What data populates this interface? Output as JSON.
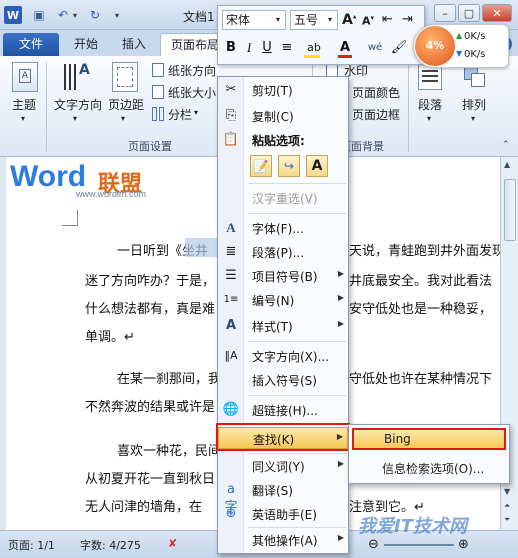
{
  "window": {
    "title": "文档1 [兼容",
    "min": "–",
    "max": "▢",
    "close": "✕"
  },
  "tabs": [
    "文件",
    "开始",
    "插入",
    "页面布局"
  ],
  "ribbon": {
    "theme_label": "主题",
    "text_direction_label": "文字方向",
    "margins_label": "页边距",
    "orientation_label": "纸张方向",
    "size_label": "纸张大小",
    "columns_label": "分栏",
    "page_setup_group": "页面设置",
    "watermark_label": "水印",
    "page_color_label": "页面颜色",
    "page_border_label": "页面边框",
    "page_background_group": "页面背景",
    "paragraph_label": "段落",
    "arrange_label": "排列"
  },
  "mini_toolbar": {
    "font": "宋体",
    "size": "五号"
  },
  "speed": {
    "percent": "4%",
    "up": "0K/s",
    "down": "0K/s"
  },
  "logo": {
    "text_word": "Word",
    "text_cn": "联盟",
    "site": "www.wordlm.com"
  },
  "document": {
    "lines": [
      "一日听到《坐井",
      "迷了方向咋办？于是，",
      "什么想法都有，真是难",
      "单调。↵",
      "在某一刹那间，我",
      "不然奔波的结果或许是",
      "喜欢一种花，民间",
      "从初夏开花一直到秋日",
      "无人问津的墙角，在"
    ],
    "right_lines": [
      "天说，青蛙跑到井外面发现",
      "井底最安全。我对此看法",
      "安守低处也是一种稳妥，",
      "守低处也许在某种情况下",
      "注意到它。↵"
    ]
  },
  "context_menu": {
    "cut": "剪切(T)",
    "copy": "复制(C)",
    "paste_options": "粘贴选项:",
    "reconvert": "汉字重选(V)",
    "font": "字体(F)...",
    "paragraph": "段落(P)...",
    "bullets": "项目符号(B)",
    "numbering": "编号(N)",
    "styles": "样式(T)",
    "text_direction": "文字方向(X)...",
    "insert_symbol": "插入符号(S)",
    "hyperlink": "超链接(H)...",
    "find": "查找(K)",
    "synonyms": "同义词(Y)",
    "translate": "翻译(S)",
    "english_assistant": "英语助手(E)",
    "other_actions": "其他操作(A)"
  },
  "submenu": {
    "bing": "Bing",
    "research": "信息检索选项(O)..."
  },
  "status": {
    "page": "页面: 1/1",
    "words": "字数: 4/275"
  },
  "watermark_site": "我爱IT技术网"
}
